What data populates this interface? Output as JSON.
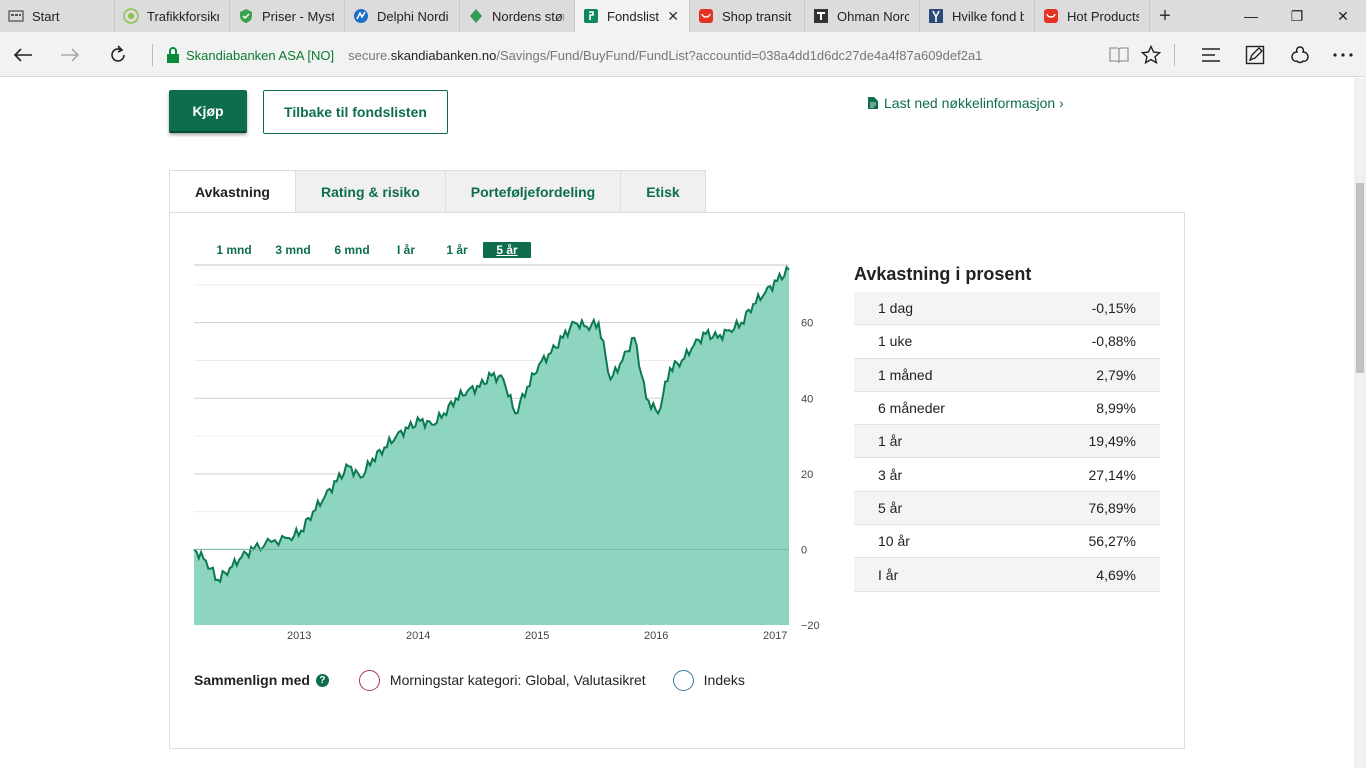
{
  "browser": {
    "tabs": [
      {
        "label": "Start",
        "icon": "start-page-icon",
        "color": "#555555"
      },
      {
        "label": "Trafikkforsikr",
        "icon": "site-favicon",
        "color": "#8bc34a"
      },
      {
        "label": "Priser - Myst",
        "icon": "shield-favicon",
        "color": "#3ba34a"
      },
      {
        "label": "Delphi Nordi",
        "icon": "delphi-favicon",
        "color": "#1e6ec8"
      },
      {
        "label": "Nordens stør",
        "icon": "leaf-favicon",
        "color": "#2f9e52"
      },
      {
        "label": "Fondslist",
        "icon": "skandiabanken-favicon",
        "color": "#0e8a5a",
        "active": true
      },
      {
        "label": "Shop transit",
        "icon": "aliexpress-favicon",
        "color": "#e43225"
      },
      {
        "label": "Ohman Norc",
        "icon": "ohman-favicon",
        "color": "#333333"
      },
      {
        "label": "Hvilke fond b",
        "icon": "fork-favicon",
        "color": "#2b4a7a"
      },
      {
        "label": "Hot Products",
        "icon": "aliexpress-favicon",
        "color": "#e43225"
      }
    ],
    "tab_close": "✕",
    "new_tab": "+",
    "window": {
      "minimize": "—",
      "restore": "❐",
      "close": "✕"
    },
    "address": {
      "site_identity": "Skandiabanken ASA [NO]",
      "url_prefix": "secure.",
      "url_host": "skandiabanken.no",
      "url_rest": "/Savings/Fund/BuyFund/FundList?accountid=038a4dd1d6dc27de4a4f87a609def2a1"
    }
  },
  "actions": {
    "buy": "Kjøp",
    "back": "Tilbake til fondslisten",
    "download": "Last ned nøkkelinformasjon ›"
  },
  "tabs": [
    "Avkastning",
    "Rating & risiko",
    "Porteføljefordeling",
    "Etisk"
  ],
  "periods": [
    "1 mnd",
    "3 mnd",
    "6 mnd",
    "I år",
    "1 år",
    "5 år"
  ],
  "active_period": "5 år",
  "compare": {
    "label": "Sammenlign med",
    "options": [
      "Morningstar kategori: Global, Valutasikret",
      "Indeks"
    ]
  },
  "returns": {
    "title": "Avkastning i prosent",
    "rows": [
      {
        "period": "1 dag",
        "value": "-0,15%"
      },
      {
        "period": "1 uke",
        "value": "-0,88%"
      },
      {
        "period": "1 måned",
        "value": "2,79%"
      },
      {
        "period": "6 måneder",
        "value": "8,99%"
      },
      {
        "period": "1 år",
        "value": "19,49%"
      },
      {
        "period": "3 år",
        "value": "27,14%"
      },
      {
        "period": "5 år",
        "value": "76,89%"
      },
      {
        "period": "10 år",
        "value": "56,27%"
      },
      {
        "period": "I år",
        "value": "4,69%"
      }
    ]
  },
  "colors": {
    "brand": "#0e6e4b",
    "chart_fill": "#8dd5c0",
    "chart_line": "#0b7a4f"
  },
  "chart_data": {
    "type": "area",
    "title": "",
    "xlabel": "",
    "ylabel": "",
    "x_ticks": [
      "2013",
      "2014",
      "2015",
      "2016",
      "2017"
    ],
    "y_ticks": [
      -20,
      0,
      20,
      40,
      60
    ],
    "ylim": [
      -20,
      75
    ],
    "xlim": [
      2012.2,
      2017.2
    ],
    "grid": true,
    "series": [
      {
        "values": [
          [
            2012.2,
            0
          ],
          [
            2012.3,
            -3
          ],
          [
            2012.4,
            -8
          ],
          [
            2012.5,
            -5
          ],
          [
            2012.6,
            -2
          ],
          [
            2012.7,
            0
          ],
          [
            2012.85,
            2
          ],
          [
            2013.0,
            3
          ],
          [
            2013.1,
            5
          ],
          [
            2013.2,
            10
          ],
          [
            2013.3,
            14
          ],
          [
            2013.4,
            18
          ],
          [
            2013.5,
            22
          ],
          [
            2013.6,
            19
          ],
          [
            2013.7,
            24
          ],
          [
            2013.8,
            27
          ],
          [
            2013.9,
            30
          ],
          [
            2014.0,
            32
          ],
          [
            2014.1,
            34
          ],
          [
            2014.2,
            33
          ],
          [
            2014.3,
            36
          ],
          [
            2014.4,
            40
          ],
          [
            2014.5,
            42
          ],
          [
            2014.6,
            43
          ],
          [
            2014.7,
            46
          ],
          [
            2014.8,
            45
          ],
          [
            2014.9,
            36
          ],
          [
            2015.0,
            43
          ],
          [
            2015.1,
            49
          ],
          [
            2015.2,
            52
          ],
          [
            2015.3,
            56
          ],
          [
            2015.4,
            60
          ],
          [
            2015.5,
            59
          ],
          [
            2015.6,
            60
          ],
          [
            2015.7,
            45
          ],
          [
            2015.8,
            50
          ],
          [
            2015.9,
            56
          ],
          [
            2016.0,
            40
          ],
          [
            2016.1,
            36
          ],
          [
            2016.2,
            48
          ],
          [
            2016.3,
            50
          ],
          [
            2016.4,
            54
          ],
          [
            2016.5,
            57
          ],
          [
            2016.6,
            56
          ],
          [
            2016.7,
            58
          ],
          [
            2016.8,
            60
          ],
          [
            2016.9,
            65
          ],
          [
            2017.0,
            68
          ],
          [
            2017.1,
            71
          ],
          [
            2017.2,
            74
          ]
        ]
      }
    ]
  }
}
